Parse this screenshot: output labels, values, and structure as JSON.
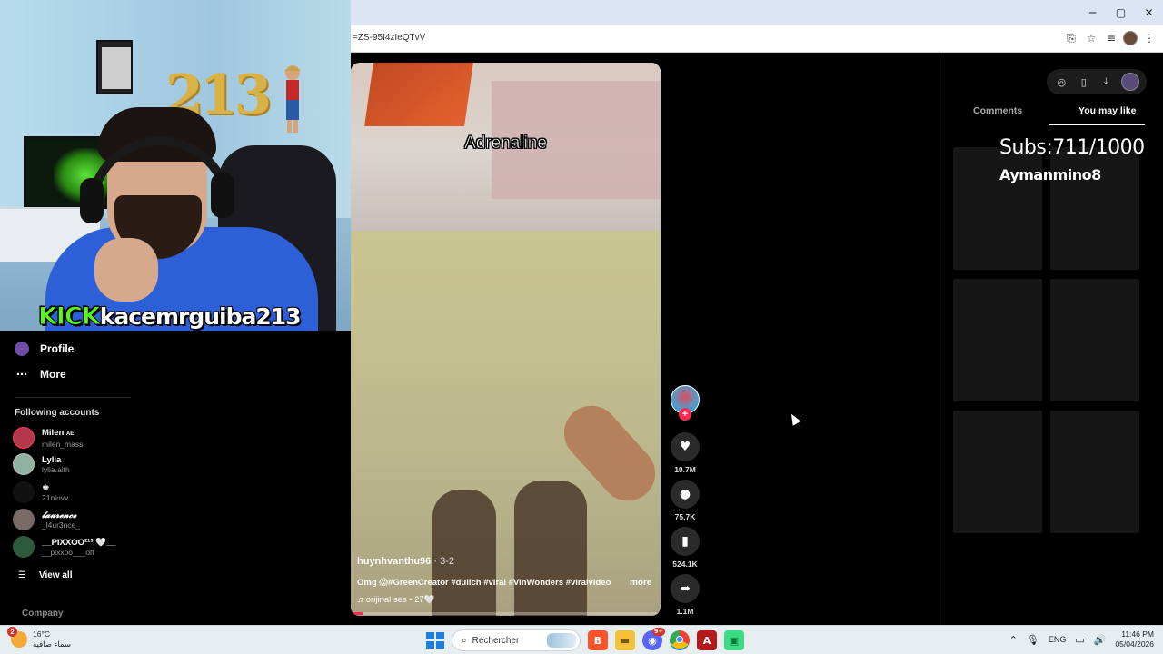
{
  "browser": {
    "url": "=ZS-95I4zIeQTvV",
    "window_controls": [
      "─",
      "▢",
      "✕"
    ],
    "addr_icons": [
      "install-icon",
      "star-icon",
      "media-icon",
      "profile-avatar",
      "menu-icon"
    ]
  },
  "stream_overlay": {
    "platform": "KICK",
    "username": "kacemrguiba213",
    "balloons_text": "213"
  },
  "sidebar": {
    "profile_label": "Profile",
    "more_label": "More",
    "following_header": "Following accounts",
    "accounts": [
      {
        "name": "Milen",
        "suffix": "AE",
        "handle": "milen_mass",
        "color": "#b2384a"
      },
      {
        "name": "Lylia",
        "suffix": "",
        "handle": "lylia.aith",
        "color": "#8fb3a0"
      },
      {
        "name": "♚",
        "suffix": "",
        "handle": "21nluvv",
        "color": "#111111"
      },
      {
        "name": "𝓵𝓪𝓾𝓻𝓮𝓷𝓬𝓮",
        "suffix": "",
        "handle": "_l4ur3nce_",
        "color": "#7a6a66"
      },
      {
        "name": "__PIXXOO²¹³ 🤍__",
        "suffix": "",
        "handle": "__pixxoo___off",
        "color": "#2d5a3a"
      }
    ],
    "view_all_label": "View all",
    "company_label": "Company"
  },
  "video": {
    "caption": "Adrenaline",
    "author": "huynhvanthu96",
    "date": "· 3-2",
    "description": "Omg 😱#GreenCreator #dulich #viral #VinWonders #viralvideo",
    "more_label": "more",
    "sound": "♫  orijinal ses - 27🤍",
    "progress": 0.04
  },
  "actions": {
    "likes": "10.7M",
    "comments": "75.7K",
    "saves": "524.1K",
    "shares": "1.1M"
  },
  "right_panel": {
    "tab_comments": "Comments",
    "tab_you_may_like": "You may like",
    "subs_text": "Subs:711/1000",
    "subs_name": "Aymanmino8"
  },
  "taskbar": {
    "weather_temp": "16°C",
    "weather_desc": "سماء صافية",
    "weather_badge": "2",
    "search_placeholder": "Rechercher",
    "discord_badge": "9+",
    "lang": "ENG",
    "time": "11:46 PM",
    "date": "05/04/2026"
  }
}
